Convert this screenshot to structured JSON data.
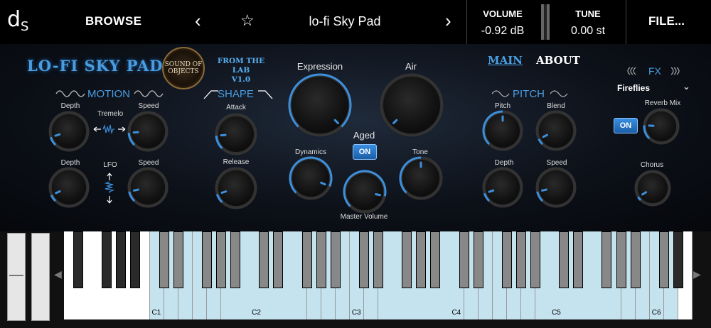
{
  "header": {
    "logo": "d",
    "logo_sub": "S",
    "browse": "BROWSE",
    "prev_arrow": "‹",
    "next_arrow": "›",
    "favorite_icon": "star-outline",
    "preset_name": "lo-fi Sky Pad",
    "volume_label": "VOLUME",
    "volume_value": "-0.92 dB",
    "tune_label": "TUNE",
    "tune_value": "0.00 st",
    "file": "FILE..."
  },
  "branding": {
    "title": "LO-FI SKY PAD",
    "maker_logo": "SOUND OF OBJECTS",
    "from_lab_line1": "FROM THE LAB",
    "from_lab_line2": "V1.0"
  },
  "nav": {
    "main": "MAIN",
    "about": "ABOUT"
  },
  "motion": {
    "title": "MOTION",
    "tremolo_label": "Tremelo",
    "lfo_label": "LFO",
    "tremolo_depth": {
      "label": "Depth",
      "value": 0.1
    },
    "tremolo_speed": {
      "label": "Speed",
      "value": 0.15
    },
    "lfo_depth": {
      "label": "Depth",
      "value": 0.08
    },
    "lfo_speed": {
      "label": "Speed",
      "value": 0.12
    }
  },
  "shape": {
    "title": "SHAPE",
    "attack": {
      "label": "Attack",
      "value": 0.15
    },
    "release": {
      "label": "Release",
      "value": 0.1
    }
  },
  "center": {
    "expression": {
      "label": "Expression",
      "value": 1.0
    },
    "air": {
      "label": "Air",
      "value": 0.0
    },
    "aged_label": "Aged",
    "aged_toggle": "ON",
    "dynamics": {
      "label": "Dynamics",
      "value": 0.92
    },
    "tone": {
      "label": "Tone",
      "value": 0.5
    },
    "master_volume": {
      "label": "Master Volume",
      "value": 0.88
    }
  },
  "pitch": {
    "title": "PITCH",
    "pitch": {
      "label": "Pitch",
      "value": 0.5
    },
    "blend": {
      "label": "Blend",
      "value": 0.07
    },
    "depth": {
      "label": "Depth",
      "value": 0.1
    },
    "speed": {
      "label": "Speed",
      "value": 0.12
    }
  },
  "fx": {
    "title": "FX",
    "preset": "Fireflies",
    "toggle": "ON",
    "reverb_mix": {
      "label": "Reverb Mix",
      "value": 0.18
    },
    "chorus": {
      "label": "Chorus",
      "value": 0.05
    }
  },
  "keyboard": {
    "octave_labels": [
      "C1",
      "C2",
      "C3",
      "C4",
      "C5",
      "C6"
    ],
    "left_arrow": "◀",
    "right_arrow": "▶"
  },
  "colors": {
    "accent": "#3d8fdc",
    "key_highlight": "#c4e3ef",
    "background": "#000000"
  }
}
